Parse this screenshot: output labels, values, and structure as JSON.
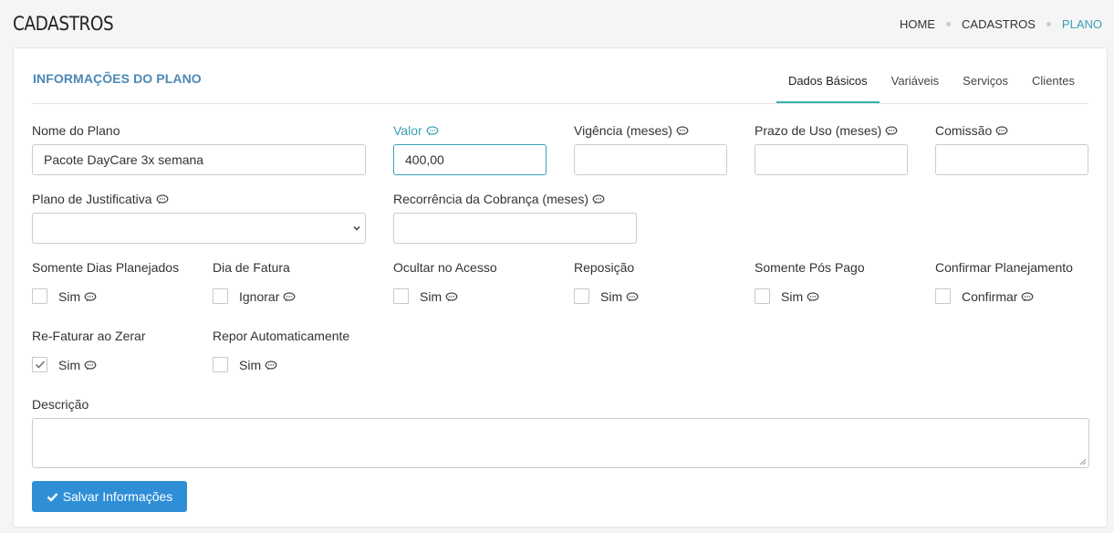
{
  "page": {
    "title": "CADASTROS"
  },
  "breadcrumb": [
    "HOME",
    "CADASTROS",
    "PLANO"
  ],
  "panel": {
    "title": "INFORMAÇÕES DO PLANO"
  },
  "tabs": [
    "Dados Básicos",
    "Variáveis",
    "Serviços",
    "Clientes"
  ],
  "fields": {
    "nome": {
      "label": "Nome do Plano",
      "value": "Pacote DayCare 3x semana"
    },
    "valor": {
      "label": "Valor",
      "value": "400,00"
    },
    "vigencia": {
      "label": "Vigência (meses)",
      "value": ""
    },
    "prazo": {
      "label": "Prazo de Uso (meses)",
      "value": ""
    },
    "comissao": {
      "label": "Comissão",
      "value": ""
    },
    "justificativa": {
      "label": "Plano de Justificativa",
      "value": ""
    },
    "recorrencia": {
      "label": "Recorrência da Cobrança (meses)",
      "value": ""
    },
    "descricao": {
      "label": "Descrição",
      "value": ""
    }
  },
  "checkgroups": [
    {
      "label": "Somente Dias Planejados",
      "option": "Sim",
      "checked": false
    },
    {
      "label": "Dia de Fatura",
      "option": "Ignorar",
      "checked": false
    },
    {
      "label": "Ocultar no Acesso",
      "option": "Sim",
      "checked": false
    },
    {
      "label": "Reposição",
      "option": "Sim",
      "checked": false
    },
    {
      "label": "Somente Pós Pago",
      "option": "Sim",
      "checked": false
    },
    {
      "label": "Confirmar Planejamento",
      "option": "Confirmar",
      "checked": false
    },
    {
      "label": "Re-Faturar ao Zerar",
      "option": "Sim",
      "checked": true
    },
    {
      "label": "Repor Automaticamente",
      "option": "Sim",
      "checked": false
    }
  ],
  "actions": {
    "save": "Salvar Informações"
  },
  "colors": {
    "accent": "#3aa0b5",
    "tab_active": "#38b2b0",
    "primary_button": "#2e8fd6",
    "panel_title": "#4b88b6"
  },
  "icons": {
    "comment": "comment-icon",
    "check": "check-icon",
    "chevron": "chevron-down-icon"
  }
}
